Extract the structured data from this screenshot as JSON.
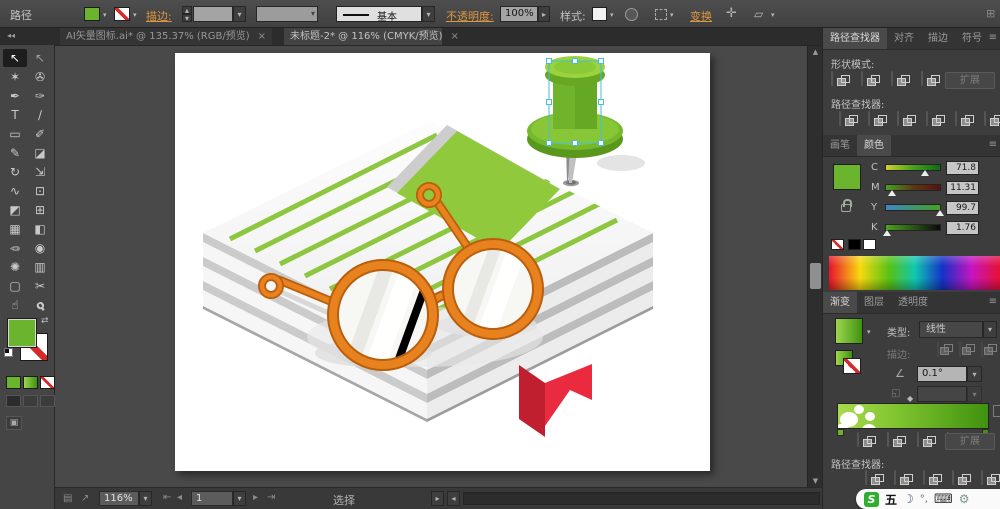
{
  "control_bar": {
    "context_label": "路径",
    "stroke_label": "描边:",
    "basic_style": "基本",
    "opacity_label": "不透明度:",
    "opacity_value": "100%",
    "style_label": "样式:",
    "transform_label": "变换"
  },
  "tabs": [
    {
      "label": "AI矢量图标.ai* @ 135.37% (RGB/预览)",
      "close": "×"
    },
    {
      "label": "未标题-2* @ 116% (CMYK/预览)",
      "close": "×"
    }
  ],
  "toolbar": {
    "collapse": "◂◂",
    "tools": [
      {
        "name": "selection",
        "glyph": "↖"
      },
      {
        "name": "direct-selection",
        "glyph": "↖"
      },
      {
        "name": "magic-wand",
        "glyph": "✶"
      },
      {
        "name": "lasso",
        "glyph": "✇"
      },
      {
        "name": "pen",
        "glyph": "✒"
      },
      {
        "name": "curvature",
        "glyph": "✑"
      },
      {
        "name": "type",
        "glyph": "T"
      },
      {
        "name": "line-segment",
        "glyph": "∕"
      },
      {
        "name": "rectangle",
        "glyph": "▭"
      },
      {
        "name": "paintbrush",
        "glyph": "✐"
      },
      {
        "name": "pencil",
        "glyph": "✎"
      },
      {
        "name": "eraser",
        "glyph": "◪"
      },
      {
        "name": "rotate",
        "glyph": "↻"
      },
      {
        "name": "scale",
        "glyph": "⇲"
      },
      {
        "name": "width",
        "glyph": "∿"
      },
      {
        "name": "free-transform",
        "glyph": "⊡"
      },
      {
        "name": "shape-builder",
        "glyph": "◩"
      },
      {
        "name": "perspective-grid",
        "glyph": "⊞"
      },
      {
        "name": "mesh",
        "glyph": "▦"
      },
      {
        "name": "gradient",
        "glyph": "◧"
      },
      {
        "name": "eyedropper",
        "glyph": "✏"
      },
      {
        "name": "blend",
        "glyph": "◉"
      },
      {
        "name": "symbol-sprayer",
        "glyph": "✺"
      },
      {
        "name": "column-graph",
        "glyph": "▥"
      },
      {
        "name": "artboard",
        "glyph": "▢"
      },
      {
        "name": "slice",
        "glyph": "✂"
      },
      {
        "name": "hand",
        "glyph": "☝"
      },
      {
        "name": "zoom",
        "glyph": "ϙ"
      }
    ]
  },
  "dock": {
    "pathfinder": {
      "tabs": [
        "路径查找器",
        "对齐",
        "描边",
        "符号"
      ],
      "shape_mode_label": "形状模式:",
      "expand_label": "扩展",
      "pathfinder_label": "路径查找器:"
    },
    "color": {
      "tabs": [
        "画笔",
        "颜色"
      ],
      "sliders": [
        {
          "channel": "C",
          "value": "71.8",
          "percent": 71.8
        },
        {
          "channel": "M",
          "value": "11.31",
          "percent": 11.31
        },
        {
          "channel": "Y",
          "value": "99.7",
          "percent": 99.7
        },
        {
          "channel": "K",
          "value": "1.76",
          "percent": 1.76
        }
      ]
    },
    "gradient": {
      "tabs": [
        "渐变",
        "图层",
        "透明度"
      ],
      "type_label": "类型:",
      "type_value": "线性",
      "stroke_label": "描边:",
      "angle_value": "0.1°"
    },
    "pathfinder2": {
      "expand_label": "扩展",
      "pathfinder_label": "路径查找器:"
    }
  },
  "status_bar": {
    "zoom_value": "116%",
    "page_value": "1",
    "tool_label": "选择"
  },
  "ime": {
    "logo": "S",
    "mode": "五",
    "moon": "☽",
    "punct": "°,",
    "keyboard": "⌨",
    "menu": "⚙"
  },
  "colors": {
    "accent_orange": "#dd9740",
    "fill_green": "#6ab52d",
    "selection_cyan": "#49bdd6",
    "bookmark_red": "#ea2a3e"
  }
}
